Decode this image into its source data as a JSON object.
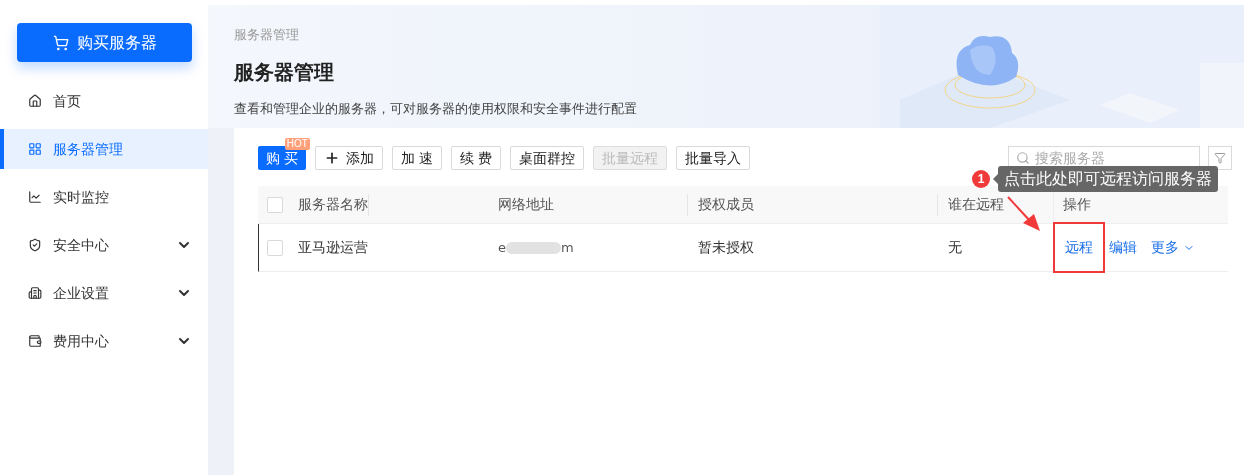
{
  "sidebar": {
    "buy_button": "购买服务器",
    "items": [
      {
        "label": "首页",
        "selected": false,
        "expandable": false
      },
      {
        "label": "服务器管理",
        "selected": true,
        "expandable": false
      },
      {
        "label": "实时监控",
        "selected": false,
        "expandable": false
      },
      {
        "label": "安全中心",
        "selected": false,
        "expandable": true
      },
      {
        "label": "企业设置",
        "selected": false,
        "expandable": true
      },
      {
        "label": "费用中心",
        "selected": false,
        "expandable": true
      }
    ]
  },
  "header": {
    "breadcrumb": "服务器管理",
    "title": "服务器管理",
    "description": "查看和管理企业的服务器，可对服务器的使用权限和安全事件进行配置"
  },
  "toolbar": {
    "buttons": [
      {
        "label": "购 买",
        "kind": "primary",
        "disabled": false,
        "badge": "HOT"
      },
      {
        "label": "添加",
        "kind": "add",
        "disabled": false
      },
      {
        "label": "加 速",
        "kind": "default",
        "disabled": false
      },
      {
        "label": "续 费",
        "kind": "default",
        "disabled": false
      },
      {
        "label": "桌面群控",
        "kind": "default",
        "disabled": false
      },
      {
        "label": "批量远程",
        "kind": "default",
        "disabled": true
      },
      {
        "label": "批量导入",
        "kind": "default",
        "disabled": false
      }
    ],
    "search": {
      "placeholder": "搜索服务器"
    }
  },
  "table": {
    "columns": [
      "服务器名称",
      "网络地址",
      "授权成员",
      "谁在远程",
      "操作"
    ],
    "header_checked": false,
    "rows": [
      {
        "checked": false,
        "name": "亚马逊运营",
        "address_start": "e",
        "address_end": "m",
        "members": "暂未授权",
        "remote_user": "无",
        "actions": [
          {
            "label": "远程",
            "highlighted": true,
            "caret": false
          },
          {
            "label": "编辑",
            "highlighted": false,
            "caret": false
          },
          {
            "label": "更多",
            "highlighted": false,
            "caret": true
          }
        ]
      }
    ]
  },
  "annotation": {
    "step": "1",
    "text": "点击此处即可远程访问服务器"
  }
}
